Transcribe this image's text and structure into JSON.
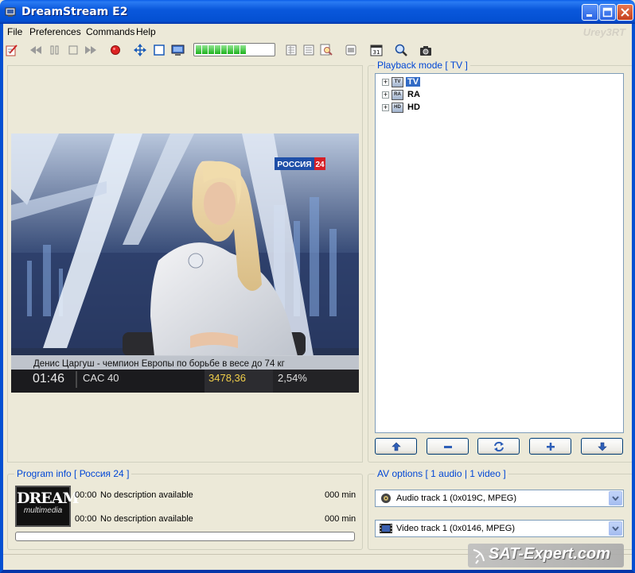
{
  "window": {
    "title": "DreamStream E2"
  },
  "menu": {
    "items": [
      "File",
      "Preferences",
      "Commands",
      "Help"
    ],
    "watermark": "Urey3RT"
  },
  "toolbar": {
    "icons": [
      "edit-icon",
      "rewind-icon",
      "pause-icon",
      "stop-icon",
      "forward-icon",
      "record-icon",
      "move-icon",
      "window-icon",
      "screen-icon",
      "list-icon",
      "list2-icon",
      "search-doc-icon",
      "lines-icon",
      "calendar-icon",
      "zoom-icon",
      "camera-icon"
    ],
    "calendar_label": "31",
    "signal_segments": 8
  },
  "video": {
    "channel_logo": "РОССИЯ",
    "channel_number": "24",
    "ticker_text": "Денис Царгуш - чемпион Европы по борьбе в весе до 74 кг",
    "time": "01:46",
    "index_name": "CAC 40",
    "index_value": "3478,36",
    "index_change": "2,54%"
  },
  "playback": {
    "title": "Playback mode [ TV ]",
    "tree": [
      {
        "icon_label": "TV",
        "label": "TV",
        "selected": true
      },
      {
        "icon_label": "RA",
        "label": "RA",
        "selected": false
      },
      {
        "icon_label": "HD",
        "label": "HD",
        "selected": false
      }
    ]
  },
  "program": {
    "title": "Program info [ Россия 24 ]",
    "logo_main": "DREAM",
    "logo_sub": "multimedia",
    "rows": [
      {
        "time": "00:00",
        "desc": "No description available",
        "duration": "000 min"
      },
      {
        "time": "00:00",
        "desc": "No description available",
        "duration": "000 min"
      }
    ]
  },
  "av": {
    "title": "AV options [ 1 audio | 1 video ]",
    "audio_track": "Audio track 1 (0x019C, MPEG)",
    "video_track": "Video track 1 (0x0146, MPEG)"
  },
  "watermark": {
    "text": "SAT-Expert.com"
  }
}
